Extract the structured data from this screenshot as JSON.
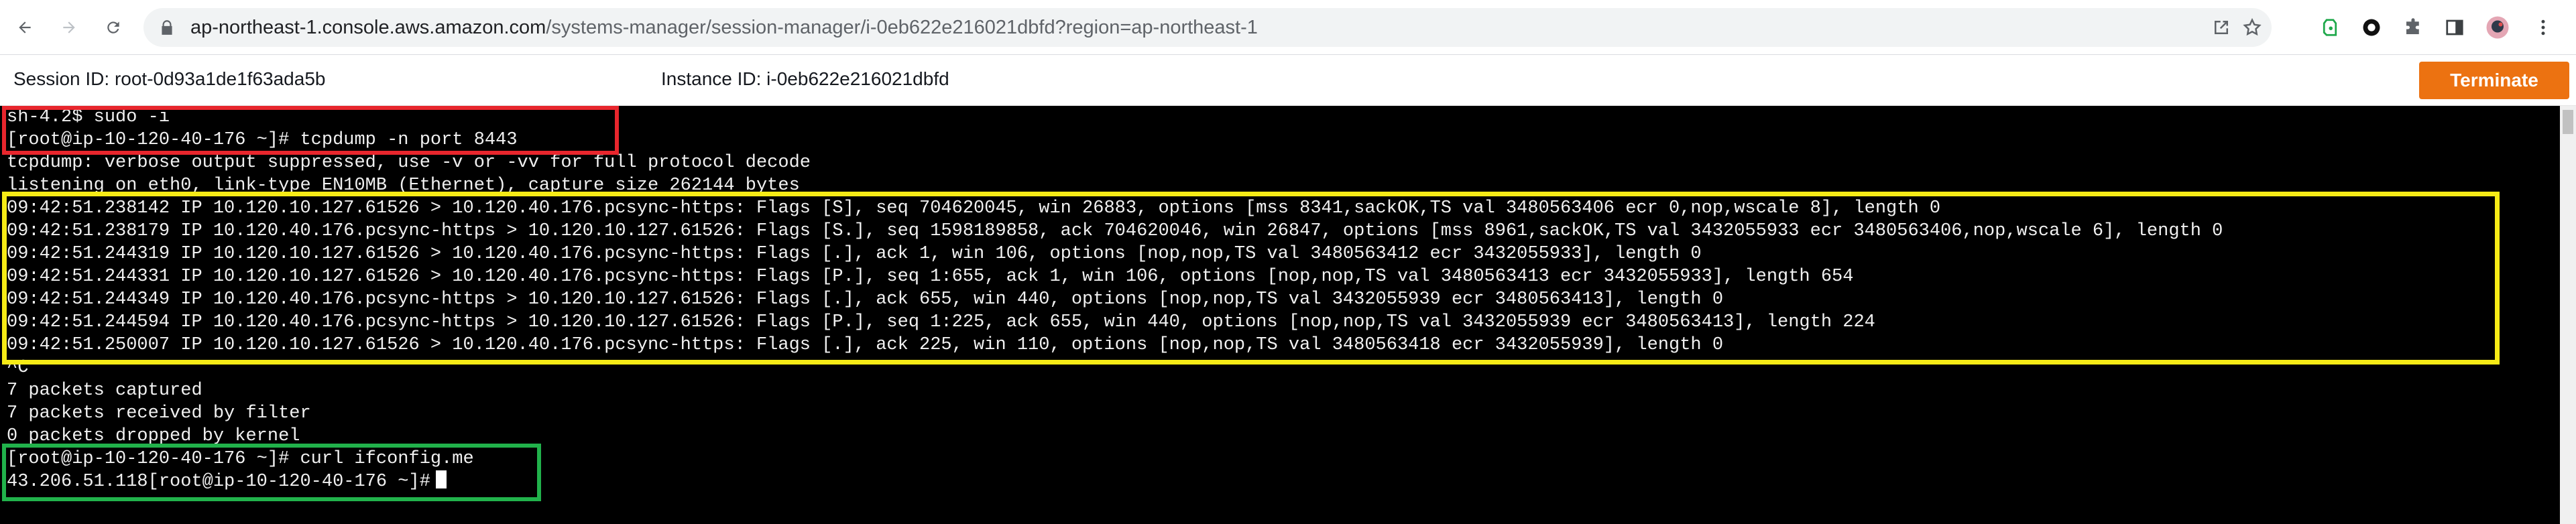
{
  "browser": {
    "url_host": "ap-northeast-1.console.aws.amazon.com",
    "url_path": "/systems-manager/session-manager/i-0eb622e216021dbfd?region=ap-northeast-1",
    "icons": [
      "back-arrow-icon",
      "forward-arrow-icon",
      "reload-icon",
      "lock-icon",
      "share-icon",
      "star-icon",
      "evernote-icon",
      "circle-extension-icon",
      "puzzle-extensions-icon",
      "sidepanel-icon",
      "profile-avatar",
      "kebab-menu-icon"
    ]
  },
  "session": {
    "session_id": "Session ID: root-0d93a1de1f63ada5b",
    "instance_id": "Instance ID: i-0eb622e216021dbfd",
    "terminate_label": "Terminate",
    "accent": "#ec7211"
  },
  "terminal": {
    "lines": [
      "sh-4.2$ sudo -i",
      "[root@ip-10-120-40-176 ~]# tcpdump -n port 8443",
      "tcpdump: verbose output suppressed, use -v or -vv for full protocol decode",
      "listening on eth0, link-type EN10MB (Ethernet), capture size 262144 bytes",
      "09:42:51.238142 IP 10.120.10.127.61526 > 10.120.40.176.pcsync-https: Flags [S], seq 704620045, win 26883, options [mss 8341,sackOK,TS val 3480563406 ecr 0,nop,wscale 8], length 0",
      "09:42:51.238179 IP 10.120.40.176.pcsync-https > 10.120.10.127.61526: Flags [S.], seq 1598189858, ack 704620046, win 26847, options [mss 8961,sackOK,TS val 3432055933 ecr 3480563406,nop,wscale 6], length 0",
      "09:42:51.244319 IP 10.120.10.127.61526 > 10.120.40.176.pcsync-https: Flags [.], ack 1, win 106, options [nop,nop,TS val 3480563412 ecr 3432055933], length 0",
      "09:42:51.244331 IP 10.120.10.127.61526 > 10.120.40.176.pcsync-https: Flags [P.], seq 1:655, ack 1, win 106, options [nop,nop,TS val 3480563413 ecr 3432055933], length 654",
      "09:42:51.244349 IP 10.120.40.176.pcsync-https > 10.120.10.127.61526: Flags [.], ack 655, win 440, options [nop,nop,TS val 3432055939 ecr 3480563413], length 0",
      "09:42:51.244594 IP 10.120.40.176.pcsync-https > 10.120.10.127.61526: Flags [P.], seq 1:225, ack 655, win 440, options [nop,nop,TS val 3432055939 ecr 3480563413], length 224",
      "09:42:51.250007 IP 10.120.10.127.61526 > 10.120.40.176.pcsync-https: Flags [.], ack 225, win 110, options [nop,nop,TS val 3480563418 ecr 3432055939], length 0",
      "^C",
      "7 packets captured",
      "7 packets received by filter",
      "0 packets dropped by kernel",
      "[root@ip-10-120-40-176 ~]# curl ifconfig.me",
      "43.206.51.118[root@ip-10-120-40-176 ~]#"
    ]
  },
  "highlights": {
    "colors": {
      "red": "#e8262d",
      "yellow": "#f6eb16",
      "green": "#21b24b"
    }
  }
}
